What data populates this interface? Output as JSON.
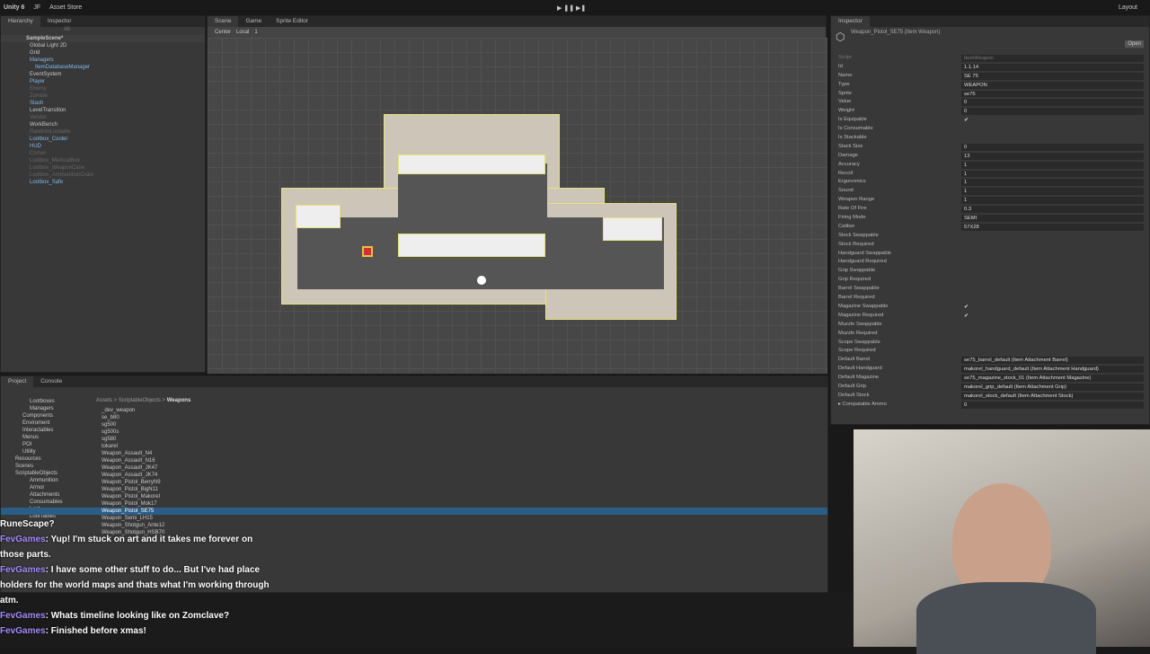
{
  "topbar": {
    "app": "Unity 6",
    "account": "JF",
    "store": "Asset Store",
    "layout": "Layout"
  },
  "hierarchy": {
    "tab": "Hierarchy",
    "search": "All",
    "scene": "SampleScene*",
    "items": [
      {
        "label": "Global Light 2D",
        "style": ""
      },
      {
        "label": "Grid",
        "style": ""
      },
      {
        "label": "Managers",
        "style": "blue"
      },
      {
        "label": "ItemDatabaseManager",
        "style": "blue"
      },
      {
        "label": "EventSystem",
        "style": ""
      },
      {
        "label": "Player",
        "style": "blue"
      },
      {
        "label": "Enemy",
        "style": "dim"
      },
      {
        "label": "Zombie",
        "style": "dim"
      },
      {
        "label": "Stash",
        "style": "blue"
      },
      {
        "label": "LevelTransition",
        "style": ""
      },
      {
        "label": "Vendor",
        "style": "dim"
      },
      {
        "label": "WorkBench",
        "style": ""
      },
      {
        "label": "RandomLootable",
        "style": "dim"
      },
      {
        "label": "Lootbox_Cooler",
        "style": "blue"
      },
      {
        "label": "HUD",
        "style": "blue"
      },
      {
        "label": "Corner",
        "style": "dim"
      },
      {
        "label": "Lootbox_MedicalBox",
        "style": "dim"
      },
      {
        "label": "Lootbox_WeaponCase",
        "style": "dim"
      },
      {
        "label": "Lootbox_AmmunitionCrate",
        "style": "dim"
      },
      {
        "label": "Lootbox_Safe",
        "style": "blue"
      }
    ]
  },
  "scene": {
    "tabs": [
      "Inspector",
      "Scene",
      "Game",
      "Sprite Editor"
    ],
    "pivot": "Center",
    "space": "Local",
    "snap": "1"
  },
  "inspector": {
    "tab": "Inspector",
    "title": "Weapon_Pistol_SE75 (Item Weapon)",
    "open": "Open",
    "rows": [
      {
        "label": "Script",
        "value": "ItemWeapon"
      },
      {
        "label": "Id",
        "value": "1.1.14"
      },
      {
        "label": "Name",
        "value": "SE 75"
      },
      {
        "label": "Type",
        "value": "WEAPON"
      },
      {
        "label": "Sprite",
        "value": "se75"
      },
      {
        "label": "Value",
        "value": "0"
      },
      {
        "label": "Weight",
        "value": "0"
      },
      {
        "label": "Is Equipable",
        "value": "✔"
      },
      {
        "label": "Is Consumable",
        "value": ""
      },
      {
        "label": "Is Stackable",
        "value": ""
      },
      {
        "label": "Stack Size",
        "value": "0"
      },
      {
        "label": "Damage",
        "value": "13"
      },
      {
        "label": "Accuracy",
        "value": "1"
      },
      {
        "label": "Recoil",
        "value": "1"
      },
      {
        "label": "Ergonomics",
        "value": "1"
      },
      {
        "label": "Sound",
        "value": "1"
      },
      {
        "label": "Weapon Range",
        "value": "1"
      },
      {
        "label": "Rate Of Fire",
        "value": "0.3"
      },
      {
        "label": "Firing Mode",
        "value": "SEMI"
      },
      {
        "label": "Caliber",
        "value": "57X28"
      },
      {
        "label": "Stock Swappable",
        "value": ""
      },
      {
        "label": "Stock Required",
        "value": ""
      },
      {
        "label": "Handguard Swappable",
        "value": ""
      },
      {
        "label": "Handguard Required",
        "value": ""
      },
      {
        "label": "Grip Swappable",
        "value": ""
      },
      {
        "label": "Grip Required",
        "value": ""
      },
      {
        "label": "Barrel Swappable",
        "value": ""
      },
      {
        "label": "Barrel Required",
        "value": ""
      },
      {
        "label": "Magazine Swappable",
        "value": "✔"
      },
      {
        "label": "Magazine Required",
        "value": "✔"
      },
      {
        "label": "Muzzle Swappable",
        "value": ""
      },
      {
        "label": "Muzzle Required",
        "value": ""
      },
      {
        "label": "Scope Swappable",
        "value": ""
      },
      {
        "label": "Scope Required",
        "value": ""
      },
      {
        "label": "Default Barrel",
        "value": "se75_barrel_default (Item Attachment Barrel)"
      },
      {
        "label": "Default Handguard",
        "value": "makorel_handguard_default (Item Attachment Handguard)"
      },
      {
        "label": "Default Magazine",
        "value": "se75_magazine_stock_01 (Item Attachment Magazine)"
      },
      {
        "label": "Default Grip",
        "value": "makorel_grip_default (Item Attachment Grip)"
      },
      {
        "label": "Default Stock",
        "value": "makorel_stock_default (Item Attachment Stock)"
      },
      {
        "label": "▸ Compatable Ammo",
        "value": "0"
      }
    ]
  },
  "project": {
    "tabs": [
      "Project",
      "Console"
    ],
    "breadcrumb": [
      "Assets",
      "ScriptableObjects",
      "Weapons"
    ],
    "folders": [
      "Lootboxes",
      "Managers",
      "Components",
      "Enviroment",
      "Interactables",
      "Menus",
      "POI",
      "Utility",
      "Resources",
      "Scenes",
      "ScriptableObjects",
      "Ammunition",
      "Armor",
      "Attachments",
      "Consumables",
      "Loot",
      "LootTables"
    ],
    "files": [
      "_dev_weapon",
      "se_b80",
      "sg500",
      "sg500s",
      "sg580",
      "tokarel",
      "Weapon_Assault_N4",
      "Weapon_Assault_N16",
      "Weapon_Assault_JK47",
      "Weapon_Assault_JK74",
      "Weapon_Pistol_BerryN9",
      "Weapon_Pistol_BigN11",
      "Weapon_Pistol_Makorel",
      "Weapon_Pistol_Mok17",
      "Weapon_Pistol_SE75",
      "Weapon_Semi_LH15",
      "Weapon_Shotgun_Ante12",
      "Weapon_Shotgun_HSB70"
    ],
    "selected": 14
  },
  "chat": [
    {
      "user": "",
      "text": "RuneScape?"
    },
    {
      "user": "FevGames",
      "text": ": Yup! I'm stuck on art and it takes me forever on those parts."
    },
    {
      "user": "FevGames",
      "text": ": I have some other stuff to do... But I've had place holders for the world maps and thats what I'm working through atm."
    },
    {
      "user": "FevGames",
      "text": ": Whats timeline looking like on Zomclave?"
    },
    {
      "user": "FevGames",
      "text": ": Finished before xmas!"
    }
  ]
}
